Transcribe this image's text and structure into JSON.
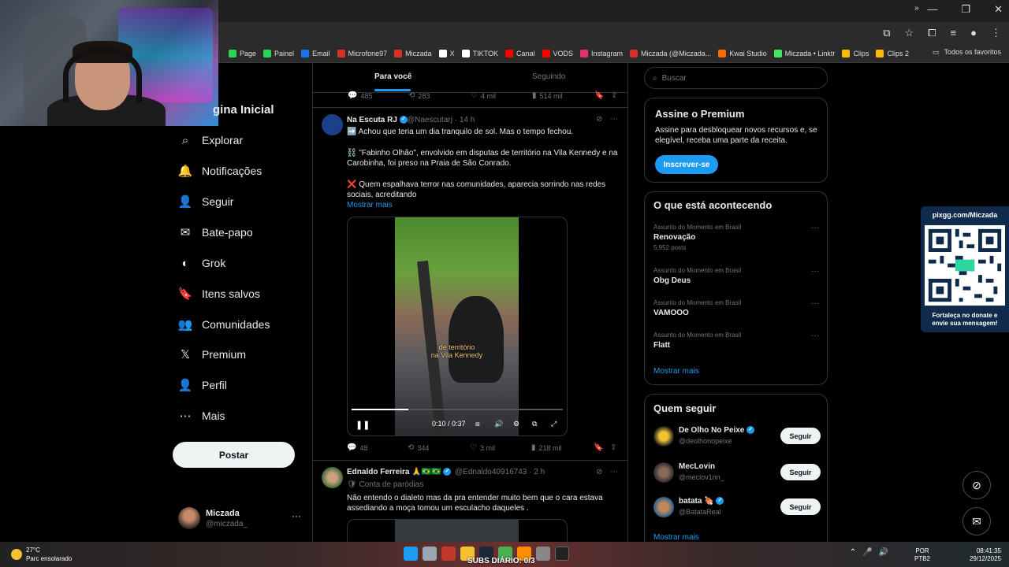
{
  "browser": {
    "bookmarks": [
      {
        "label": "Page",
        "color": "#2bd654"
      },
      {
        "label": "Painel",
        "color": "#2bd654"
      },
      {
        "label": "Email",
        "color": "#1a73e8"
      },
      {
        "label": "Microfone97",
        "color": "#d93025"
      },
      {
        "label": "Miczada",
        "color": "#d93025"
      },
      {
        "label": "X",
        "color": "#ffffff"
      },
      {
        "label": "TIKTOK",
        "color": "#ffffff"
      },
      {
        "label": "Canal",
        "color": "#ff0000"
      },
      {
        "label": "VODS",
        "color": "#ff0000"
      },
      {
        "label": "Instagram",
        "color": "#e1306c"
      },
      {
        "label": "Miczada (@Miczada...",
        "color": "#d93025"
      },
      {
        "label": "Kwai Studio",
        "color": "#ff6a00"
      },
      {
        "label": "Miczada • Linktr",
        "color": "#43e55e"
      },
      {
        "label": "Clips",
        "color": "#fbbc04"
      },
      {
        "label": "Clips 2",
        "color": "#fbbc04"
      }
    ],
    "more_bookmarks": "»",
    "favorites_label": "Todos os favoritos"
  },
  "nav": {
    "home": "gina Inicial",
    "items": [
      {
        "label": "Explorar",
        "icon": "⌕"
      },
      {
        "label": "Notificações",
        "icon": "🔔"
      },
      {
        "label": "Seguir",
        "icon": "👤"
      },
      {
        "label": "Bate-papo",
        "icon": "✉"
      },
      {
        "label": "Grok",
        "icon": "◐"
      },
      {
        "label": "Itens salvos",
        "icon": "🔖"
      },
      {
        "label": "Comunidades",
        "icon": "👥"
      },
      {
        "label": "Premium",
        "icon": "𝕏"
      },
      {
        "label": "Perfil",
        "icon": "👤"
      },
      {
        "label": "Mais",
        "icon": "⋯"
      }
    ],
    "post_button": "Postar",
    "profile": {
      "name": "Miczada",
      "handle": "@miczada_",
      "more": "···"
    }
  },
  "feed": {
    "tabs": {
      "active": "Para você",
      "inactive": "Seguindo"
    },
    "top_actions": {
      "replies": "485",
      "reposts": "283",
      "likes": "4 mil",
      "views": "514 mil"
    },
    "tweet1": {
      "name": "Na Escuta RJ",
      "meta": "@Naescutarj · 14 h",
      "line1": "➡️ Achou que teria um dia tranquilo de sol. Mas o tempo fechou.",
      "line2": "⛓️ \"Fabinho Olhão\", envolvido em disputas de território na Vila Kennedy e na Carobinha, foi preso na Praia de São Conrado.",
      "line3": "❌ Quem espalhava terror nas comunidades, aparecia sorrindo nas redes sociais, acreditando",
      "more": "Mostrar mais",
      "video": {
        "subtitle1": "de território",
        "subtitle2": "na Vila Kennedy",
        "time": "0:10 / 0:37",
        "progress": 0.27
      },
      "actions": {
        "replies": "48",
        "reposts": "344",
        "likes": "3 mil",
        "views": "218 mil"
      }
    },
    "tweet2": {
      "name": "Ednaldo Ferreira 🙏🇧🇷🇧🇷",
      "meta": "@Ednaldo40916743 · 2 h",
      "parody": "🛡 Conta de paródias",
      "text": "Não entendo o dialeto mas da pra entender muito bem que o cara estava assediando a moça tomou um esculacho daqueles ."
    }
  },
  "sidebar": {
    "search_placeholder": "Buscar",
    "premium": {
      "title": "Assine o Premium",
      "text": "Assine para desbloquear novos recursos e, se elegível, receba uma parte da receita.",
      "button": "Inscrever-se"
    },
    "trends": {
      "title": "O que está acontecendo",
      "items": [
        {
          "context": "Assunto do Momento em Brasil",
          "topic": "Renovação",
          "count": "5.952 posts"
        },
        {
          "context": "Assunto do Momento em Brasil",
          "topic": "Obg Deus",
          "count": ""
        },
        {
          "context": "Assunto do Momento em Brasil",
          "topic": "VAMOOO",
          "count": ""
        },
        {
          "context": "Assunto do Momento em Brasil",
          "topic": "Flatt",
          "count": ""
        }
      ],
      "show_more": "Mostrar mais"
    },
    "who_to_follow": {
      "title": "Quem seguir",
      "items": [
        {
          "name": "De Olho No Peixe",
          "handle": "@deolhonopeixe",
          "button": "Seguir"
        },
        {
          "name": "MecLovin",
          "handle": "@meclov1nn_",
          "button": "Seguir"
        },
        {
          "name": "batata 🍖",
          "handle": "@BatataReal",
          "button": "Seguir"
        }
      ],
      "show_more": "Mostrar mais"
    }
  },
  "overlay": {
    "qr_title": "pixgg.com/Miczada",
    "qr_caption": "Fortaleça no donate e envie sua mensagem!",
    "subs": "SUBS DIÁRIO: 0/3"
  },
  "taskbar": {
    "temp": "27°C",
    "condition": "Parc ensolarado",
    "lang1": "POR",
    "lang2": "PTB2",
    "time": "08:41:35",
    "date": "29/12/2025"
  }
}
